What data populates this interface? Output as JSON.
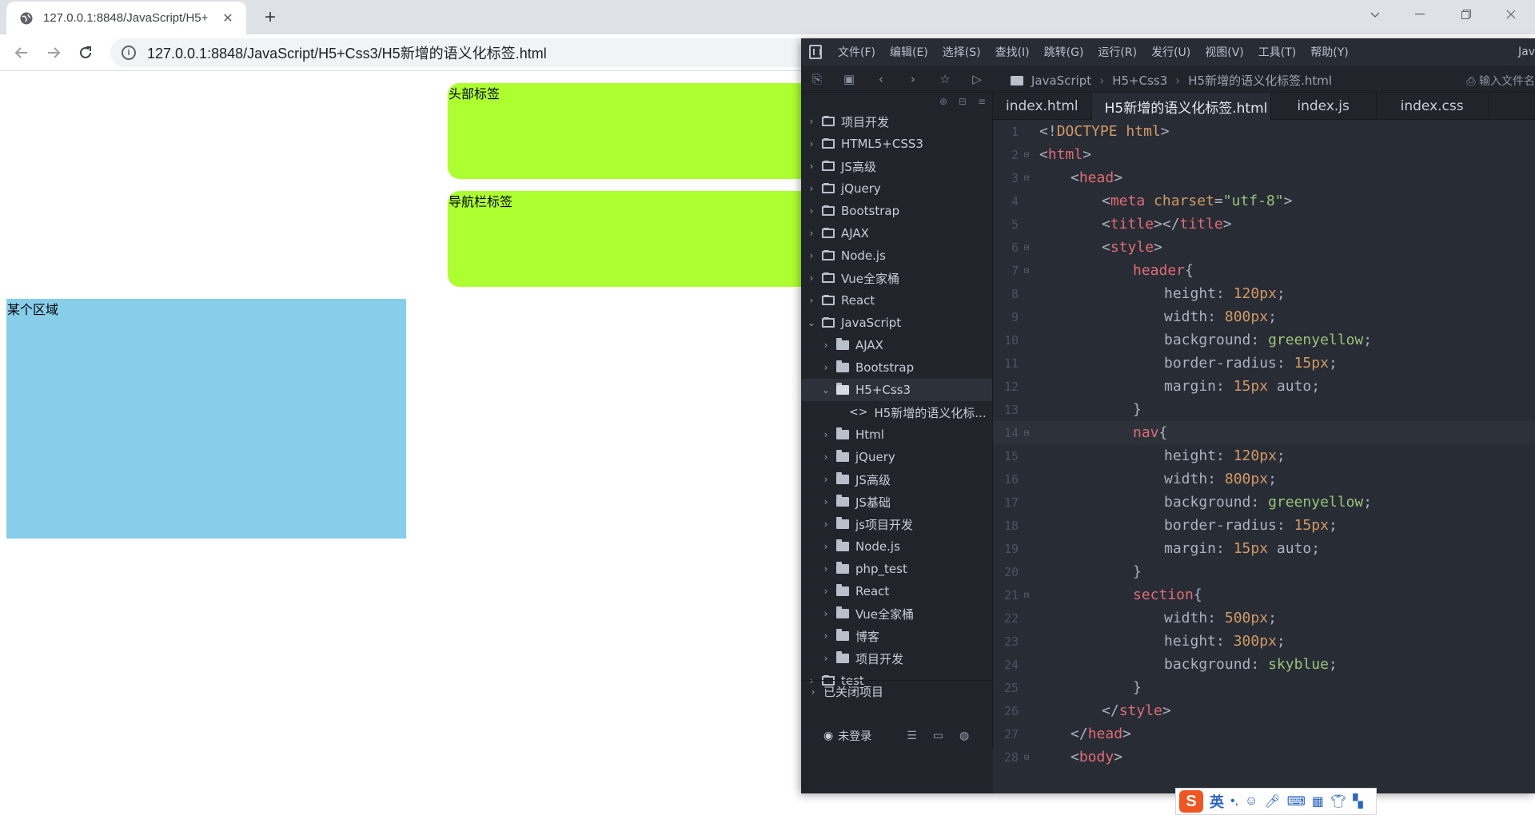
{
  "browser": {
    "tab_title": "127.0.0.1:8848/JavaScript/H5+",
    "url": "127.0.0.1:8848/JavaScript/H5+Css3/H5新增的语义化标签.html"
  },
  "page": {
    "header_text": "头部标签",
    "nav_text": "导航栏标签",
    "section_text": "某个区域"
  },
  "ide": {
    "menu": [
      "文件(F)",
      "编辑(E)",
      "选择(S)",
      "查找(I)",
      "跳转(G)",
      "运行(R)",
      "发行(U)",
      "视图(V)",
      "工具(T)",
      "帮助(Y)"
    ],
    "menu_extra": "Jav",
    "breadcrumb": [
      "JavaScript",
      "H5+Css3",
      "H5新增的语义化标签.html"
    ],
    "search_hint": "输入文件名",
    "tabs": [
      "index.html",
      "H5新增的语义化标签.html",
      "index.js",
      "index.css"
    ],
    "active_tab": 1,
    "tree": [
      {
        "label": "项目开发",
        "depth": 0,
        "kind": "project",
        "expanded": false
      },
      {
        "label": "HTML5+CSS3",
        "depth": 0,
        "kind": "project",
        "expanded": false
      },
      {
        "label": "JS高级",
        "depth": 0,
        "kind": "project",
        "expanded": false
      },
      {
        "label": "jQuery",
        "depth": 0,
        "kind": "project",
        "expanded": false
      },
      {
        "label": "Bootstrap",
        "depth": 0,
        "kind": "project",
        "expanded": false
      },
      {
        "label": "AJAX",
        "depth": 0,
        "kind": "project",
        "expanded": false
      },
      {
        "label": "Node.js",
        "depth": 0,
        "kind": "project",
        "expanded": false
      },
      {
        "label": "Vue全家桶",
        "depth": 0,
        "kind": "project",
        "expanded": false
      },
      {
        "label": "React",
        "depth": 0,
        "kind": "project",
        "expanded": false
      },
      {
        "label": "JavaScript",
        "depth": 0,
        "kind": "project",
        "expanded": true
      },
      {
        "label": "AJAX",
        "depth": 1,
        "kind": "folder",
        "expanded": false
      },
      {
        "label": "Bootstrap",
        "depth": 1,
        "kind": "folder",
        "expanded": false
      },
      {
        "label": "H5+Css3",
        "depth": 1,
        "kind": "folder",
        "expanded": true,
        "active": true
      },
      {
        "label": "H5新增的语义化标...",
        "depth": 2,
        "kind": "file"
      },
      {
        "label": "Html",
        "depth": 1,
        "kind": "folder",
        "expanded": false
      },
      {
        "label": "jQuery",
        "depth": 1,
        "kind": "folder",
        "expanded": false
      },
      {
        "label": "JS高级",
        "depth": 1,
        "kind": "folder",
        "expanded": false
      },
      {
        "label": "JS基础",
        "depth": 1,
        "kind": "folder",
        "expanded": false
      },
      {
        "label": "js项目开发",
        "depth": 1,
        "kind": "folder",
        "expanded": false
      },
      {
        "label": "Node.js",
        "depth": 1,
        "kind": "folder",
        "expanded": false
      },
      {
        "label": "php_test",
        "depth": 1,
        "kind": "folder",
        "expanded": false
      },
      {
        "label": "React",
        "depth": 1,
        "kind": "folder",
        "expanded": false
      },
      {
        "label": "Vue全家桶",
        "depth": 1,
        "kind": "folder",
        "expanded": false
      },
      {
        "label": "博客",
        "depth": 1,
        "kind": "folder",
        "expanded": false
      },
      {
        "label": "项目开发",
        "depth": 1,
        "kind": "folder",
        "expanded": false
      },
      {
        "label": "test",
        "depth": 0,
        "kind": "project",
        "expanded": false
      }
    ],
    "closed_projects": "已关闭项目",
    "login_status": "未登录",
    "code_lines": [
      {
        "n": "1",
        "fold": "",
        "indent": 0,
        "tokens": [
          [
            "punc",
            "<!"
          ],
          [
            "kw",
            "DOCTYPE"
          ],
          [
            "punc",
            " "
          ],
          [
            "kw",
            "html"
          ],
          [
            "punc",
            ">"
          ]
        ]
      },
      {
        "n": "2",
        "fold": "⊟",
        "indent": 0,
        "tokens": [
          [
            "punc",
            "<"
          ],
          [
            "tag",
            "html"
          ],
          [
            "punc",
            ">"
          ]
        ]
      },
      {
        "n": "3",
        "fold": "⊟",
        "indent": 1,
        "tokens": [
          [
            "punc",
            "<"
          ],
          [
            "tag",
            "head"
          ],
          [
            "punc",
            ">"
          ]
        ]
      },
      {
        "n": "4",
        "fold": "",
        "indent": 2,
        "tokens": [
          [
            "punc",
            "<"
          ],
          [
            "tag",
            "meta"
          ],
          [
            "punc",
            " "
          ],
          [
            "attr",
            "charset"
          ],
          [
            "punc",
            "="
          ],
          [
            "str",
            "\"utf-8\""
          ],
          [
            "punc",
            ">"
          ]
        ]
      },
      {
        "n": "5",
        "fold": "",
        "indent": 2,
        "tokens": [
          [
            "punc",
            "<"
          ],
          [
            "tag",
            "title"
          ],
          [
            "punc",
            "></"
          ],
          [
            "tag",
            "title"
          ],
          [
            "punc",
            ">"
          ]
        ]
      },
      {
        "n": "6",
        "fold": "⊟",
        "indent": 2,
        "tokens": [
          [
            "punc",
            "<"
          ],
          [
            "tag",
            "style"
          ],
          [
            "punc",
            ">"
          ]
        ]
      },
      {
        "n": "7",
        "fold": "⊟",
        "indent": 3,
        "tokens": [
          [
            "sel",
            "header"
          ],
          [
            "punc",
            "{"
          ]
        ]
      },
      {
        "n": "8",
        "fold": "",
        "indent": 4,
        "tokens": [
          [
            "prop",
            "height"
          ],
          [
            "punc",
            ": "
          ],
          [
            "num",
            "120px"
          ],
          [
            "punc",
            ";"
          ]
        ]
      },
      {
        "n": "9",
        "fold": "",
        "indent": 4,
        "tokens": [
          [
            "prop",
            "width"
          ],
          [
            "punc",
            ": "
          ],
          [
            "num",
            "800px"
          ],
          [
            "punc",
            ";"
          ]
        ]
      },
      {
        "n": "10",
        "fold": "",
        "indent": 4,
        "tokens": [
          [
            "prop",
            "background"
          ],
          [
            "punc",
            ": "
          ],
          [
            "val",
            "greenyellow"
          ],
          [
            "punc",
            ";"
          ]
        ]
      },
      {
        "n": "11",
        "fold": "",
        "indent": 4,
        "tokens": [
          [
            "prop",
            "border-radius"
          ],
          [
            "punc",
            ": "
          ],
          [
            "num",
            "15px"
          ],
          [
            "punc",
            ";"
          ]
        ]
      },
      {
        "n": "12",
        "fold": "",
        "indent": 4,
        "tokens": [
          [
            "prop",
            "margin"
          ],
          [
            "punc",
            ": "
          ],
          [
            "num",
            "15px"
          ],
          [
            "punc",
            " auto;"
          ]
        ]
      },
      {
        "n": "13",
        "fold": "",
        "indent": 3,
        "tokens": [
          [
            "punc",
            "}"
          ]
        ]
      },
      {
        "n": "14",
        "fold": "⊟",
        "indent": 3,
        "hl": true,
        "tokens": [
          [
            "sel",
            "nav"
          ],
          [
            "punc",
            "{"
          ]
        ]
      },
      {
        "n": "15",
        "fold": "",
        "indent": 4,
        "tokens": [
          [
            "prop",
            "height"
          ],
          [
            "punc",
            ": "
          ],
          [
            "num",
            "120px"
          ],
          [
            "punc",
            ";"
          ]
        ]
      },
      {
        "n": "16",
        "fold": "",
        "indent": 4,
        "tokens": [
          [
            "prop",
            "width"
          ],
          [
            "punc",
            ": "
          ],
          [
            "num",
            "800px"
          ],
          [
            "punc",
            ";"
          ]
        ]
      },
      {
        "n": "17",
        "fold": "",
        "indent": 4,
        "tokens": [
          [
            "prop",
            "background"
          ],
          [
            "punc",
            ": "
          ],
          [
            "val",
            "greenyellow"
          ],
          [
            "punc",
            ";"
          ]
        ]
      },
      {
        "n": "18",
        "fold": "",
        "indent": 4,
        "tokens": [
          [
            "prop",
            "border-radius"
          ],
          [
            "punc",
            ": "
          ],
          [
            "num",
            "15px"
          ],
          [
            "punc",
            ";"
          ]
        ]
      },
      {
        "n": "19",
        "fold": "",
        "indent": 4,
        "tokens": [
          [
            "prop",
            "margin"
          ],
          [
            "punc",
            ": "
          ],
          [
            "num",
            "15px"
          ],
          [
            "punc",
            " auto;"
          ]
        ]
      },
      {
        "n": "20",
        "fold": "",
        "indent": 3,
        "tokens": [
          [
            "punc",
            "}"
          ]
        ]
      },
      {
        "n": "21",
        "fold": "⊟",
        "indent": 3,
        "tokens": [
          [
            "sel",
            "section"
          ],
          [
            "punc",
            "{"
          ]
        ]
      },
      {
        "n": "22",
        "fold": "",
        "indent": 4,
        "tokens": [
          [
            "prop",
            "width"
          ],
          [
            "punc",
            ": "
          ],
          [
            "num",
            "500px"
          ],
          [
            "punc",
            ";"
          ]
        ]
      },
      {
        "n": "23",
        "fold": "",
        "indent": 4,
        "tokens": [
          [
            "prop",
            "height"
          ],
          [
            "punc",
            ": "
          ],
          [
            "num",
            "300px"
          ],
          [
            "punc",
            ";"
          ]
        ]
      },
      {
        "n": "24",
        "fold": "",
        "indent": 4,
        "tokens": [
          [
            "prop",
            "background"
          ],
          [
            "punc",
            ": "
          ],
          [
            "val",
            "skyblue"
          ],
          [
            "punc",
            ";"
          ]
        ]
      },
      {
        "n": "25",
        "fold": "",
        "indent": 3,
        "tokens": [
          [
            "punc",
            "}"
          ]
        ]
      },
      {
        "n": "26",
        "fold": "",
        "indent": 2,
        "tokens": [
          [
            "punc",
            "</"
          ],
          [
            "tag",
            "style"
          ],
          [
            "punc",
            ">"
          ]
        ]
      },
      {
        "n": "27",
        "fold": "",
        "indent": 1,
        "tokens": [
          [
            "punc",
            "</"
          ],
          [
            "tag",
            "head"
          ],
          [
            "punc",
            ">"
          ]
        ]
      },
      {
        "n": "28",
        "fold": "⊟",
        "indent": 1,
        "tokens": [
          [
            "punc",
            "<"
          ],
          [
            "tag",
            "body"
          ],
          [
            "punc",
            ">"
          ]
        ]
      }
    ]
  },
  "ime": {
    "logo": "S",
    "lang": "英"
  }
}
